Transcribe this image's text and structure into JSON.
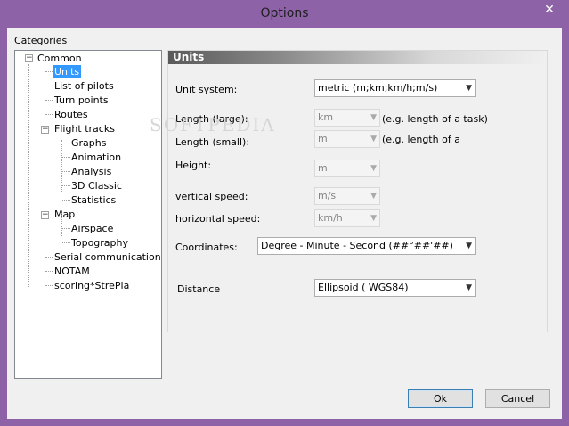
{
  "window": {
    "title": "Options",
    "close_glyph": "✕"
  },
  "categories_label": "Categories",
  "tree": {
    "common": "Common",
    "units": "Units",
    "list_of_pilots": "List of pilots",
    "turn_points": "Turn points",
    "routes": "Routes",
    "flight_tracks": "Flight tracks",
    "graphs": "Graphs",
    "animation": "Animation",
    "analysis": "Analysis",
    "classic3d": "3D Classic",
    "statistics": "Statistics",
    "map": "Map",
    "airspace": "Airspace",
    "topography": "Topography",
    "serial_communication": "Serial communication",
    "notam": "NOTAM",
    "scoring": "scoring*StrePla",
    "expand_glyph": "−"
  },
  "panel": {
    "header": "Units",
    "unit_system_label": "Unit system:",
    "unit_system_value": "metric (m;km;km/h;m/s)",
    "length_large_label": "Length (large):",
    "length_large_value": "km",
    "length_large_hint": "(e.g. length of a task)",
    "length_small_label": "Length (small):",
    "length_small_value": "m",
    "length_small_hint": "(e.g. length of a",
    "height_label": "Height:",
    "height_value": "m",
    "vertical_speed_label": "vertical speed:",
    "vertical_speed_value": "m/s",
    "horizontal_speed_label": "horizontal speed:",
    "horizontal_speed_value": "km/h",
    "coordinates_label": "Coordinates:",
    "coordinates_value": "Degree - Minute - Second (##°##'##)",
    "distance_label": "Distance",
    "distance_value": "Ellipsoid ( WGS84)",
    "arrow_glyph": "▼"
  },
  "buttons": {
    "ok": "Ok",
    "cancel": "Cancel"
  },
  "watermark": "SOFTPEDIA",
  "colors": {
    "titlebar": "#8d62a6",
    "selection": "#3399ff",
    "client": "#f0f0f0"
  }
}
